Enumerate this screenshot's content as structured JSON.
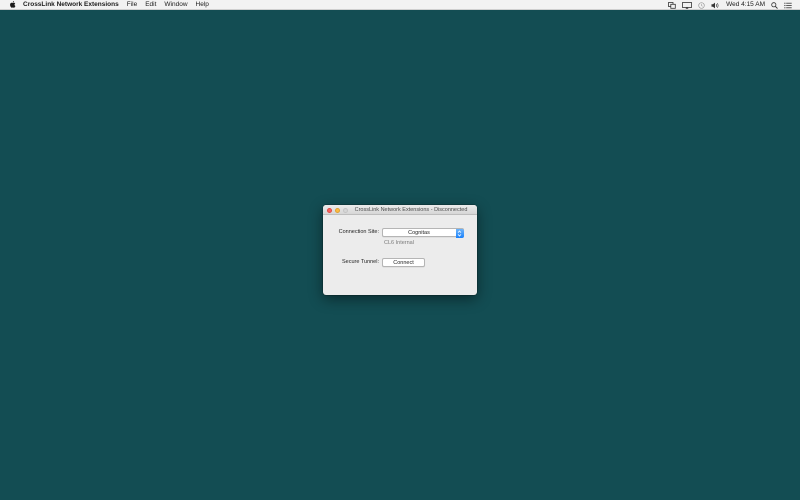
{
  "menubar": {
    "apple_icon": "apple-icon",
    "app_name": "CrossLink Network Extensions",
    "menus": [
      "File",
      "Edit",
      "Window",
      "Help"
    ],
    "status_icons": [
      "window-switch-icon",
      "screen-mirroring-icon",
      "timemachine-icon",
      "volume-icon"
    ],
    "clock": "Wed 4:15 AM",
    "right_icons": [
      "spotlight-icon",
      "notification-center-icon"
    ]
  },
  "window": {
    "title": "CrossLink Network Extensions - Disconnected",
    "connection_site_label": "Connection Site:",
    "connection_site_value": "Cognitas",
    "connection_site_detail": "CL6 Internal",
    "secure_tunnel_label": "Secure Tunnel:",
    "connect_button": "Connect"
  },
  "colors": {
    "desktop": "#134d53",
    "accent": "#1a82fb"
  }
}
